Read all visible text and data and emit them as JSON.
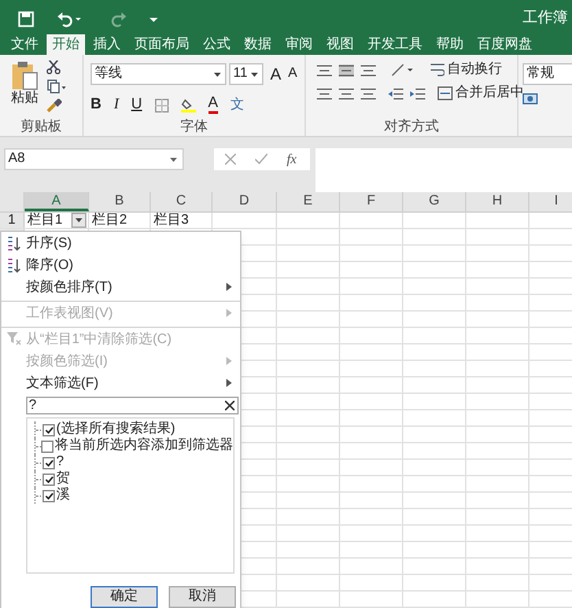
{
  "window": {
    "title": "工作簿"
  },
  "tabs": [
    {
      "label": "文件",
      "selected": false
    },
    {
      "label": "开始",
      "selected": true
    },
    {
      "label": "插入",
      "selected": false
    },
    {
      "label": "页面布局",
      "selected": false
    },
    {
      "label": "公式",
      "selected": false
    },
    {
      "label": "数据",
      "selected": false
    },
    {
      "label": "审阅",
      "selected": false
    },
    {
      "label": "视图",
      "selected": false
    },
    {
      "label": "开发工具",
      "selected": false
    },
    {
      "label": "帮助",
      "selected": false
    },
    {
      "label": "百度网盘",
      "selected": false
    }
  ],
  "ribbon": {
    "clipboard": {
      "paste": "粘贴",
      "group": "剪贴板"
    },
    "font": {
      "name": "等线",
      "size": "11",
      "grow": "A",
      "shrink": "A",
      "bold": "B",
      "italic": "I",
      "underline": "U",
      "color_letter": "A",
      "phonetic": "文",
      "group": "字体"
    },
    "alignment": {
      "wrap": "自动换行",
      "merge": "合并后居中",
      "group": "对齐方式"
    },
    "number": {
      "format": "常规"
    }
  },
  "formula_bar": {
    "name_box": "A8",
    "fx": "fx"
  },
  "sheet": {
    "columns": [
      {
        "label": "A",
        "selected": true
      },
      {
        "label": "B",
        "selected": false
      },
      {
        "label": "C",
        "selected": false
      },
      {
        "label": "D",
        "selected": false
      },
      {
        "label": "E",
        "selected": false
      },
      {
        "label": "F",
        "selected": false
      },
      {
        "label": "G",
        "selected": false
      },
      {
        "label": "H",
        "selected": false
      },
      {
        "label": "I",
        "selected": false
      }
    ],
    "rows": [
      {
        "header": "1",
        "cells": [
          "栏目1",
          "栏目2",
          "栏目3"
        ]
      }
    ]
  },
  "filter_menu": {
    "items": [
      {
        "label": "升序(S)",
        "kind": "sort-asc",
        "disabled": false,
        "submenu": false
      },
      {
        "label": "降序(O)",
        "kind": "sort-desc",
        "disabled": false,
        "submenu": false
      },
      {
        "label": "按颜色排序(T)",
        "disabled": false,
        "submenu": true,
        "separator_after": true
      },
      {
        "label": "工作表视图(V)",
        "disabled": true,
        "submenu": true,
        "separator_after": true
      },
      {
        "label": "从“栏目1”中清除筛选(C)",
        "kind": "clear-filter",
        "disabled": true,
        "submenu": false
      },
      {
        "label": "按颜色筛选(I)",
        "disabled": true,
        "submenu": true
      },
      {
        "label": "文本筛选(F)",
        "disabled": false,
        "submenu": true
      }
    ],
    "search": {
      "value": "?"
    },
    "list": [
      {
        "label": "(选择所有搜索结果)",
        "checked": true
      },
      {
        "label": "将当前所选内容添加到筛选器",
        "checked": false
      },
      {
        "label": "?",
        "checked": true
      },
      {
        "label": "贺",
        "checked": true
      },
      {
        "label": "溪",
        "checked": true
      }
    ],
    "buttons": [
      {
        "label": "确定",
        "default": true
      },
      {
        "label": "取消",
        "default": false
      }
    ]
  }
}
